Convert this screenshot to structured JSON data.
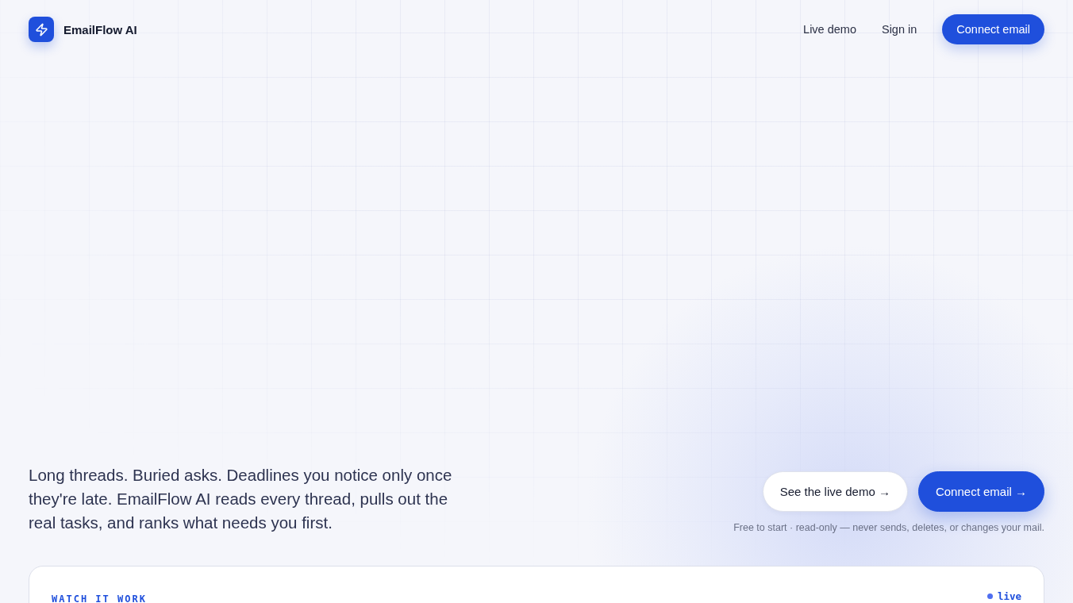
{
  "brand": {
    "name": "EmailFlow AI"
  },
  "nav": {
    "links": [
      "Live demo",
      "Sign in"
    ],
    "cta": "Connect email"
  },
  "hero": {
    "description": "Long threads. Buried asks. Deadlines you notice only once they're late. EmailFlow AI reads every thread, pulls out the real tasks, and ranks what needs you first.",
    "buttons": [
      {
        "label": "See the live demo →",
        "kind": "secondary"
      },
      {
        "label": "Connect email →",
        "kind": "primary"
      }
    ],
    "note": "Free to start · read-only — never sends, deletes, or changes your mail."
  },
  "demo_card": {
    "eyebrow": "WATCH IT WORK",
    "status": "live"
  }
}
